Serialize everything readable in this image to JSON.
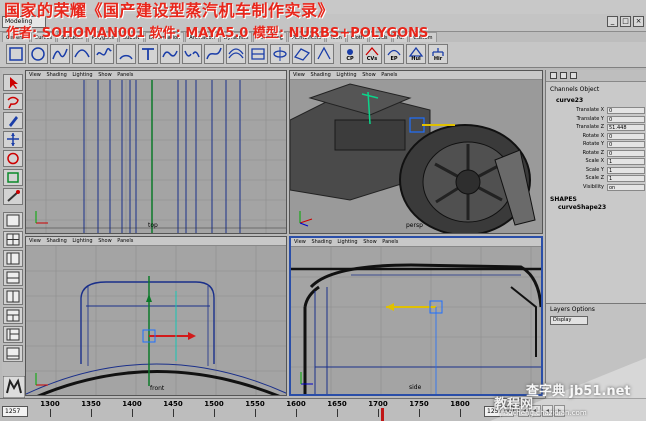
{
  "overlay": {
    "title": "国家的荣耀《国产建设型蒸汽机车制作实录》",
    "author": "作者: SOHOMAN001  软件: MAYA5.0  模型: NURBS+POLYGONS"
  },
  "statusline": {
    "mode": "Modeling"
  },
  "shelf": {
    "tabs": [
      "General",
      "Curves",
      "Surfaces",
      "Polygons",
      "Subdiv",
      "Deformation",
      "Animation",
      "Dynamics",
      "Rendering",
      "PaintEffects",
      "Toon",
      "Cloth",
      "Fluids",
      "Fur",
      "Custom"
    ],
    "labels": {
      "cp": "CP",
      "cvs": "CVs",
      "ep": "EP",
      "hull": "Hul",
      "hierarchy": "Hir"
    }
  },
  "viewports": {
    "menu": [
      "View",
      "Shading",
      "Lighting",
      "Show",
      "Panels"
    ],
    "top_label": "top",
    "persp_label": "persp",
    "front_label": "front",
    "side_label": "side"
  },
  "channel_box": {
    "header": "Channels  Object",
    "object_name": "curve23",
    "rows": [
      {
        "label": "Translate X",
        "value": "0"
      },
      {
        "label": "Translate Y",
        "value": "0"
      },
      {
        "label": "Translate Z",
        "value": "51.448"
      },
      {
        "label": "Rotate X",
        "value": "0"
      },
      {
        "label": "Rotate Y",
        "value": "0"
      },
      {
        "label": "Rotate Z",
        "value": "0"
      },
      {
        "label": "Scale X",
        "value": "1"
      },
      {
        "label": "Scale Y",
        "value": "1"
      },
      {
        "label": "Scale Z",
        "value": "1"
      },
      {
        "label": "Visibility",
        "value": "on"
      }
    ],
    "shapes_title": "SHAPES",
    "shape_name": "curveShape23",
    "layers_title": "Layers  Options",
    "layers_value": "Display"
  },
  "timeline": {
    "start_field": "1257",
    "ticks": [
      "1300",
      "1350",
      "1400",
      "1450",
      "1500",
      "1550",
      "1600",
      "1650",
      "1700",
      "1750",
      "1800"
    ],
    "end_field": "1257.00",
    "current_frame_fraction": 0.78
  },
  "watermark": {
    "main": "查字典 jb51.net",
    "cn": "教程网",
    "url": "jiaocheng.chazidian.com"
  },
  "colors": {
    "accent": "#2a4ea8",
    "overlay_red": "#e8261b",
    "viewport_bg": "#a4a4a4"
  }
}
